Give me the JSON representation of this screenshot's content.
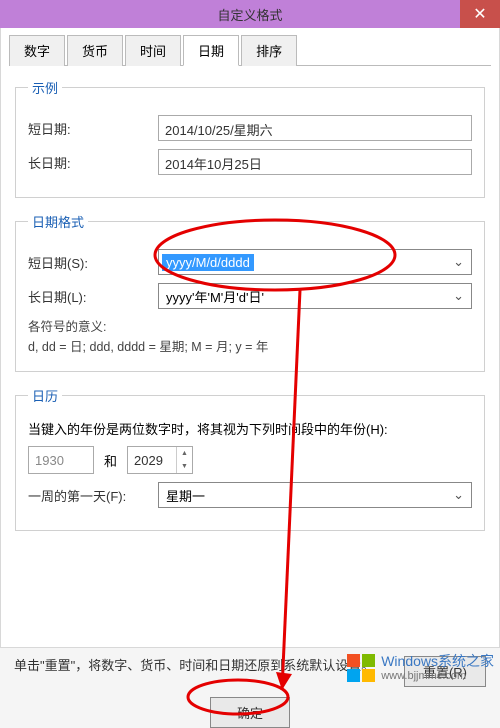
{
  "window": {
    "title": "自定义格式",
    "close": "✕"
  },
  "tabs": {
    "number": "数字",
    "currency": "货币",
    "time": "时间",
    "date": "日期",
    "sort": "排序"
  },
  "example": {
    "legend": "示例",
    "short_label": "短日期:",
    "short_value": "2014/10/25/星期六",
    "long_label": "长日期:",
    "long_value": "2014年10月25日"
  },
  "format": {
    "legend": "日期格式",
    "short_label": "短日期(S):",
    "short_value": "yyyy/M/d/dddd",
    "long_label": "长日期(L):",
    "long_value": "yyyy'年'M'月'd'日'",
    "meaning_label": "各符号的意义:",
    "meaning_text": "d, dd = 日;  ddd, dddd = 星期;  M = 月;  y = 年"
  },
  "calendar": {
    "legend": "日历",
    "two_digit_label": "当键入的年份是两位数字时，将其视为下列时间段中的年份(H):",
    "year_from": "1930",
    "between": "和",
    "year_to": "2029",
    "first_day_label": "一周的第一天(F):",
    "first_day_value": "星期一"
  },
  "footer": {
    "reset_text": "单击\"重置\"，将数字、货币、时间和日期还原到系统默认设置。",
    "reset_btn": "重置(R)",
    "ok_btn": "确定"
  },
  "watermark": {
    "line1": "Windows系统之家",
    "line2": "www.bjjmmc.com"
  },
  "chevron": "⌄"
}
